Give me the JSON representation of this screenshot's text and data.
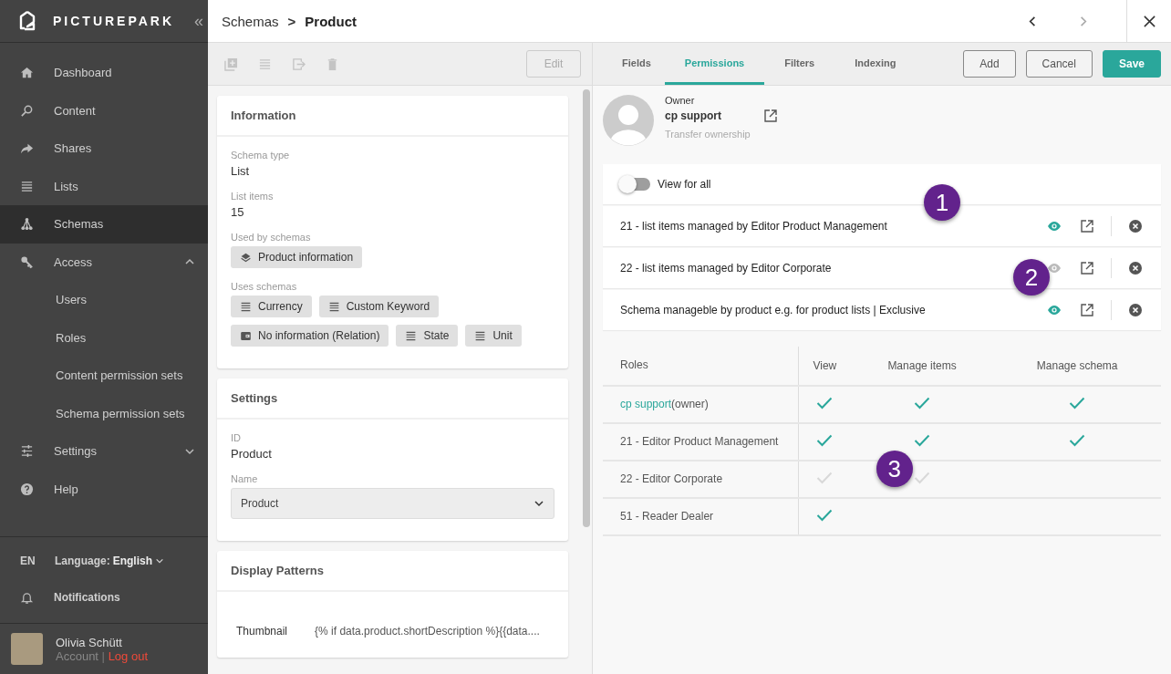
{
  "sidebar": {
    "brand": "PICTUREPARK",
    "collapse": "«",
    "items": [
      {
        "label": "Dashboard",
        "kind": "home",
        "selected": false
      },
      {
        "label": "Content",
        "kind": "search",
        "selected": false
      },
      {
        "label": "Shares",
        "kind": "share",
        "selected": false
      },
      {
        "label": "Lists",
        "kind": "list",
        "selected": false
      },
      {
        "label": "Schemas",
        "kind": "tree",
        "selected": true
      },
      {
        "label": "Access",
        "kind": "key",
        "selected": false,
        "expanded": true,
        "children": [
          {
            "label": "Users"
          },
          {
            "label": "Roles"
          },
          {
            "label": "Content permission sets"
          },
          {
            "label": "Schema permission sets"
          }
        ]
      },
      {
        "label": "Settings",
        "kind": "sliders",
        "selected": false,
        "expanded": false
      },
      {
        "label": "Help",
        "kind": "help",
        "selected": false
      }
    ],
    "language": {
      "code": "EN",
      "label": "Language:",
      "value": "English"
    },
    "notifications": "Notifications",
    "user": {
      "name": "Olivia Schütt",
      "account": "Account",
      "separator": "|",
      "logout": "Log out"
    }
  },
  "breadcrumb": {
    "parent": "Schemas",
    "separator": ">",
    "current": "Product"
  },
  "toolbar": {
    "edit": "Edit"
  },
  "cards": [
    {
      "title": "Information",
      "fields": [
        {
          "label": "Schema type",
          "value": "List"
        },
        {
          "label": "List items",
          "value": "15"
        }
      ],
      "chip_groups": [
        {
          "label": "Used by schemas",
          "chips": [
            {
              "label": "Product information",
              "kind": "layers"
            }
          ]
        },
        {
          "label": "Uses schemas",
          "chips": [
            {
              "label": "Currency",
              "kind": "list"
            },
            {
              "label": "Custom Keyword",
              "kind": "list"
            },
            {
              "label": "No information (Relation)",
              "kind": "relation"
            },
            {
              "label": "State",
              "kind": "list"
            },
            {
              "label": "Unit",
              "kind": "list"
            }
          ]
        }
      ]
    },
    {
      "title": "Settings",
      "fields": [
        {
          "label": "ID",
          "value": "Product"
        }
      ],
      "select": {
        "label": "Name",
        "value": "Product"
      }
    },
    {
      "title": "Display Patterns",
      "patterns": [
        {
          "name": "Thumbnail",
          "value": "{% if data.product.shortDescription %}{{data...."
        }
      ]
    }
  ],
  "tabs": [
    {
      "label": "Fields",
      "selected": false
    },
    {
      "label": "Permissions",
      "selected": true
    },
    {
      "label": "Filters",
      "selected": false
    },
    {
      "label": "Indexing",
      "selected": false
    }
  ],
  "actions": [
    {
      "label": "Add",
      "kind": "outline"
    },
    {
      "label": "Cancel",
      "kind": "outline"
    },
    {
      "label": "Save",
      "kind": "primary"
    }
  ],
  "owner": {
    "label": "Owner",
    "name": "cp support",
    "transfer": "Transfer ownership"
  },
  "view_for_all": {
    "label": "View for all",
    "on": false
  },
  "permission_sets": [
    {
      "name": "21 - list items managed by Editor Product Management",
      "visible": true
    },
    {
      "name": "22 - list items managed by Editor Corporate",
      "visible": false
    },
    {
      "name": "Schema manageble by product e.g. for product lists | Exclusive",
      "visible": true
    }
  ],
  "roles_table": {
    "columns": [
      "Roles",
      "View",
      "Manage items",
      "Manage schema"
    ],
    "rows": [
      {
        "link": "cp support",
        "role": "(owner)",
        "checks": [
          {
            "checked": true,
            "disabled": false
          },
          {
            "checked": true,
            "disabled": false
          },
          {
            "checked": true,
            "disabled": false
          }
        ]
      },
      {
        "role": "21 - Editor Product Management",
        "checks": [
          {
            "checked": true,
            "disabled": false
          },
          {
            "checked": true,
            "disabled": false
          },
          {
            "checked": true,
            "disabled": false
          }
        ]
      },
      {
        "role": "22 - Editor Corporate",
        "checks": [
          {
            "checked": true,
            "disabled": true
          },
          {
            "checked": true,
            "disabled": true
          },
          {
            "checked": false
          }
        ]
      },
      {
        "role": "51 - Reader Dealer",
        "checks": [
          {
            "checked": true,
            "disabled": false
          },
          {
            "checked": false
          },
          {
            "checked": false
          }
        ]
      }
    ]
  },
  "callouts": [
    {
      "label": "1"
    },
    {
      "label": "2"
    },
    {
      "label": "3"
    }
  ]
}
